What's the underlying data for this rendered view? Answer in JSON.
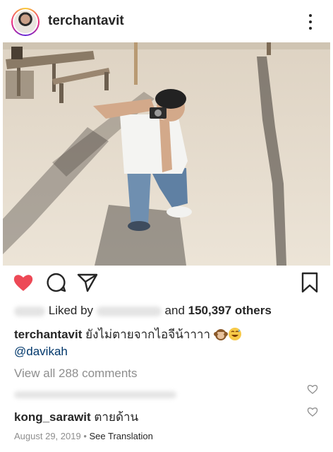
{
  "post": {
    "username": "terchantavit",
    "liked_by_prefix": "Liked by",
    "liked_by_suffix": "and",
    "others_count": "150,397 others",
    "caption_user": "terchantavit",
    "caption_text": "ยังไม่ตายจากไอจีน้าาาา",
    "caption_emojis": [
      "monkey-emoji",
      "grinning-sweat-emoji"
    ],
    "mention": "@davikah",
    "view_comments": "View all 288 comments"
  },
  "comments": [
    {
      "username": "kong_sarawit",
      "text": "ตายด้าน"
    }
  ],
  "meta": {
    "date": "August 29, 2019",
    "separator": "•",
    "see_translation": "See Translation"
  },
  "icons": {
    "like": "heart-icon",
    "comment": "comment-icon",
    "share": "share-icon",
    "save": "bookmark-icon",
    "more": "more-options-icon"
  },
  "colors": {
    "like_red": "#ed4956",
    "text": "#262626",
    "mention": "#00376b",
    "muted": "#8e8e8e"
  }
}
